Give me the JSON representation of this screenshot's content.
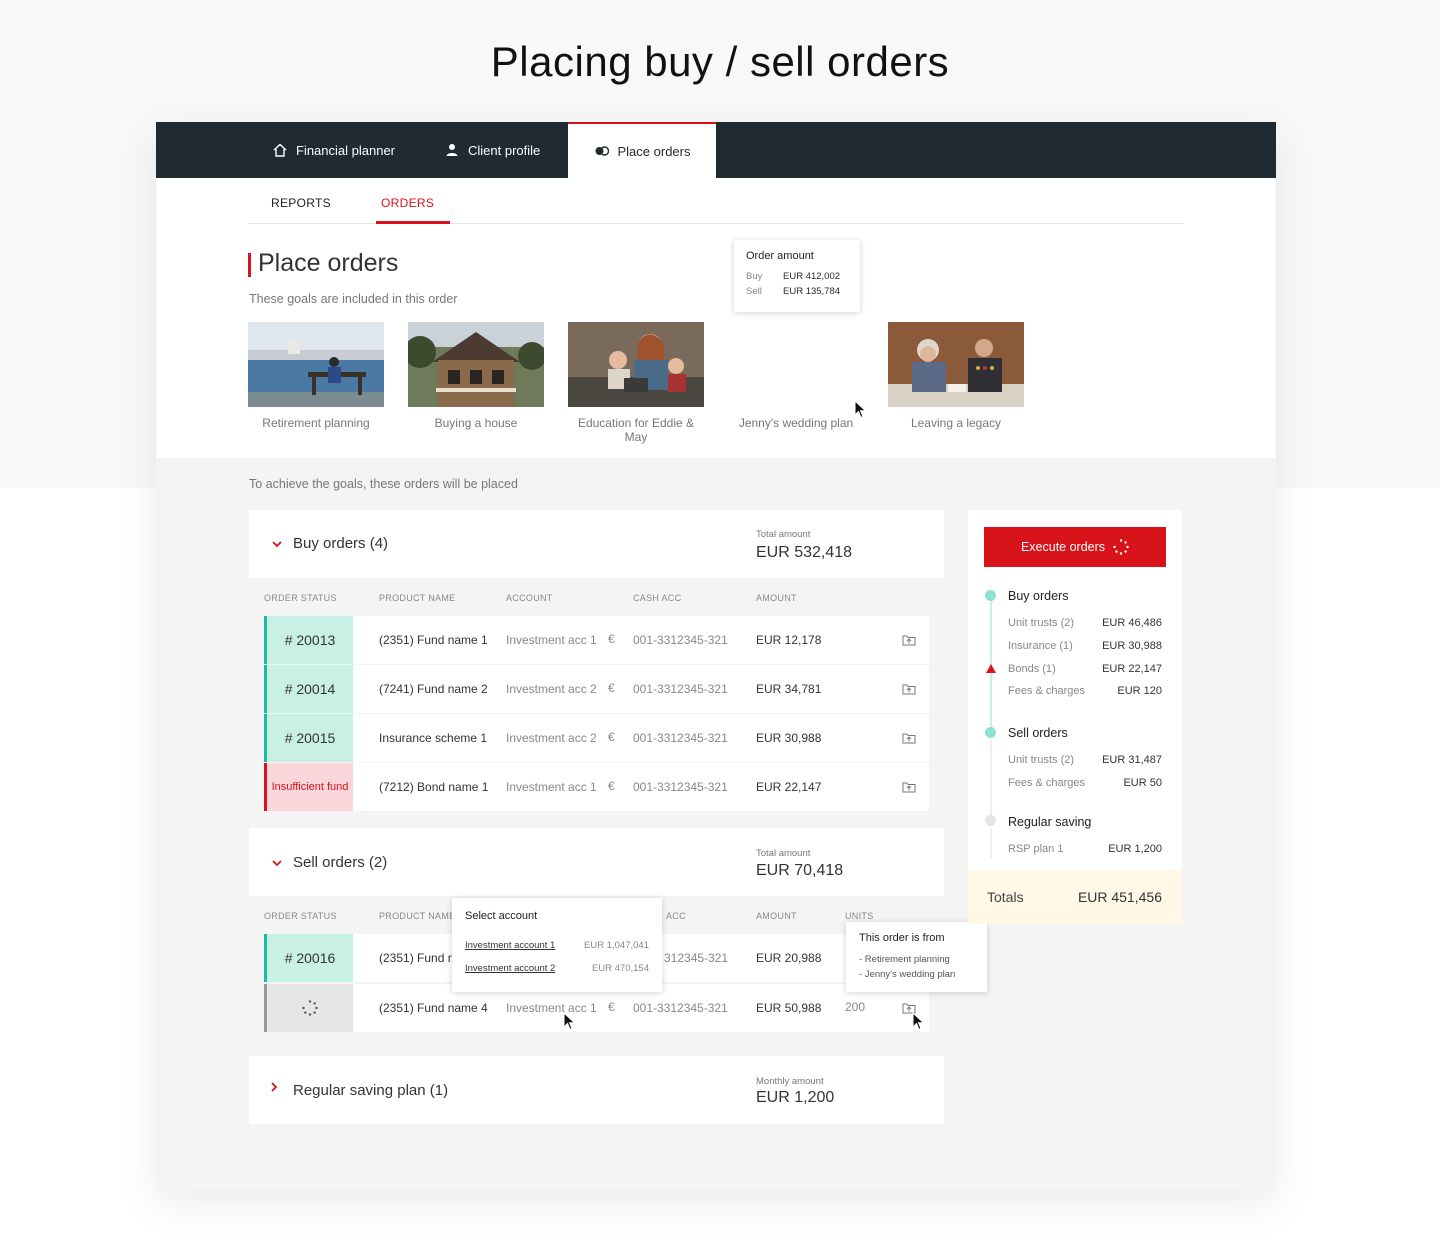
{
  "headline": "Placing buy / sell orders",
  "nav": [
    {
      "label": "Financial planner",
      "icon": "home-icon"
    },
    {
      "label": "Client profile",
      "icon": "user-icon"
    },
    {
      "label": "Place orders",
      "icon": "coins-icon",
      "active": true
    }
  ],
  "subtabs": [
    {
      "label": "REPORTS"
    },
    {
      "label": "ORDERS",
      "active": true
    }
  ],
  "page": {
    "title": "Place orders",
    "goals_intro": "These goals are included in this order",
    "orders_intro": "To achieve the goals, these orders will be placed"
  },
  "goals": [
    {
      "label": "Retirement planning"
    },
    {
      "label": "Buying a house"
    },
    {
      "label": "Education for Eddie & May"
    },
    {
      "label": "Jenny's wedding plan"
    },
    {
      "label": "Leaving a legacy"
    }
  ],
  "order_amount_tip": {
    "title": "Order amount",
    "rows": [
      {
        "k": "Buy",
        "v": "EUR 412,002"
      },
      {
        "k": "Sell",
        "v": "EUR 135,784"
      }
    ]
  },
  "columns": {
    "status": "ORDER STATUS",
    "product": "PRODUCT NAME",
    "account": "ACCOUNT",
    "cash": "CASH ACC",
    "cash_partial": "ACC",
    "amount": "AMOUNT",
    "units": "UNITS"
  },
  "buy": {
    "title": "Buy orders (4)",
    "total_label": "Total amount",
    "total": "EUR 532,418",
    "rows": [
      {
        "status": "# 20013",
        "product": "(2351) Fund name 1",
        "account": "Investment acc 1",
        "cash": "001-3312345-321",
        "amount": "EUR 12,178"
      },
      {
        "status": "# 20014",
        "product": "(7241) Fund name 2",
        "account": "Investment acc 2",
        "cash": "001-3312345-321",
        "amount": "EUR 34,781"
      },
      {
        "status": "# 20015",
        "product": "Insurance scheme 1",
        "account": "Investment acc 2",
        "cash": "001-3312345-321",
        "amount": "EUR 30,988"
      },
      {
        "status": "Insufficient fund",
        "product": "(7212) Bond name 1",
        "account": "Investment acc 1",
        "cash": "001-3312345-321",
        "amount": "EUR 22,147"
      }
    ]
  },
  "sell": {
    "title": "Sell orders (2)",
    "total_label": "Total amount",
    "total": "EUR 70,418",
    "rows": [
      {
        "status": "# 20016",
        "product": "(2351) Fund n",
        "account": "",
        "cash": "312345-321",
        "amount": "EUR 20,988",
        "units": ""
      },
      {
        "status": "",
        "product": "(2351) Fund name 4",
        "account": "Investment acc 1",
        "cash": "001-3312345-321",
        "amount": "EUR 50,988",
        "units": "200"
      }
    ]
  },
  "saving": {
    "title": "Regular saving plan (1)",
    "total_label": "Monthly amount",
    "total": "EUR 1,200"
  },
  "euro_symbol": "€",
  "select_account": {
    "title": "Select account",
    "options": [
      {
        "label": "Investment account 1",
        "amount": "EUR 1,047,041"
      },
      {
        "label": "Investment account 2",
        "amount": "EUR 470,154"
      }
    ]
  },
  "order_from": {
    "title": "This order is from",
    "items": [
      "- Retirement planning",
      "- Jenny's wedding plan"
    ]
  },
  "summary": {
    "execute_label": "Execute orders",
    "buy_title": "Buy orders",
    "buy_items": [
      {
        "k": "Unit trusts (2)",
        "v": "EUR 46,486"
      },
      {
        "k": "Insurance (1)",
        "v": "EUR 30,988"
      },
      {
        "k": "Bonds (1)",
        "v": "EUR 22,147"
      },
      {
        "k": "Fees & charges",
        "v": "EUR 120"
      }
    ],
    "sell_title": "Sell orders",
    "sell_items": [
      {
        "k": "Unit trusts (2)",
        "v": "EUR 31,487"
      },
      {
        "k": "Fees & charges",
        "v": "EUR 50"
      }
    ],
    "saving_title": "Regular saving",
    "saving_items": [
      {
        "k": "RSP plan 1",
        "v": "EUR 1,200"
      }
    ],
    "totals_label": "Totals",
    "totals_value": "EUR 451,456"
  },
  "colors": {
    "accent": "#d8131a",
    "nav_bg": "#1f2a33",
    "status_ok": "#1bbc9b",
    "status_ok_bg": "#c8f0e4",
    "status_err_bg": "#fbd6da",
    "totals_bg": "#fff8e6"
  }
}
